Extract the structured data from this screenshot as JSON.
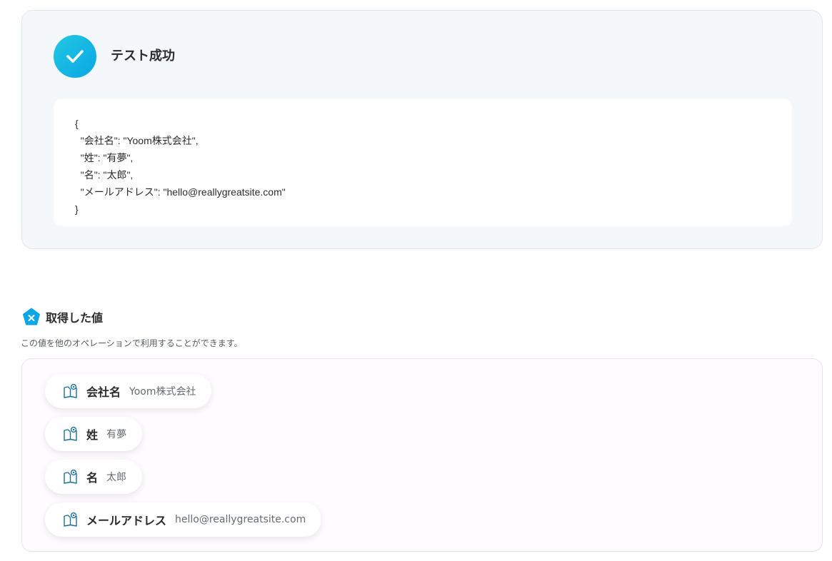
{
  "success": {
    "title": "テスト成功",
    "json_lines": [
      "{",
      "  \"会社名\": \"Yoom株式会社\",",
      "  \"姓\": \"有夢\",",
      "  \"名\": \"太郎\",",
      "  \"メールアドレス\": \"hello@reallygreatsite.com\"",
      "}"
    ]
  },
  "values": {
    "title": "取得した値",
    "description": "この値を他のオペレーションで利用することができます。",
    "items": [
      {
        "key": "会社名",
        "value": "Yoom株式会社",
        "icon": "book-icon"
      },
      {
        "key": "姓",
        "value": "有夢",
        "icon": "book-icon"
      },
      {
        "key": "名",
        "value": "太郎",
        "icon": "book-icon"
      },
      {
        "key": "メールアドレス",
        "value": "hello@reallygreatsite.com",
        "icon": "book-icon"
      }
    ]
  },
  "colors": {
    "accent": "#0aa6e6",
    "panel_bg": "#f5f8fb"
  }
}
